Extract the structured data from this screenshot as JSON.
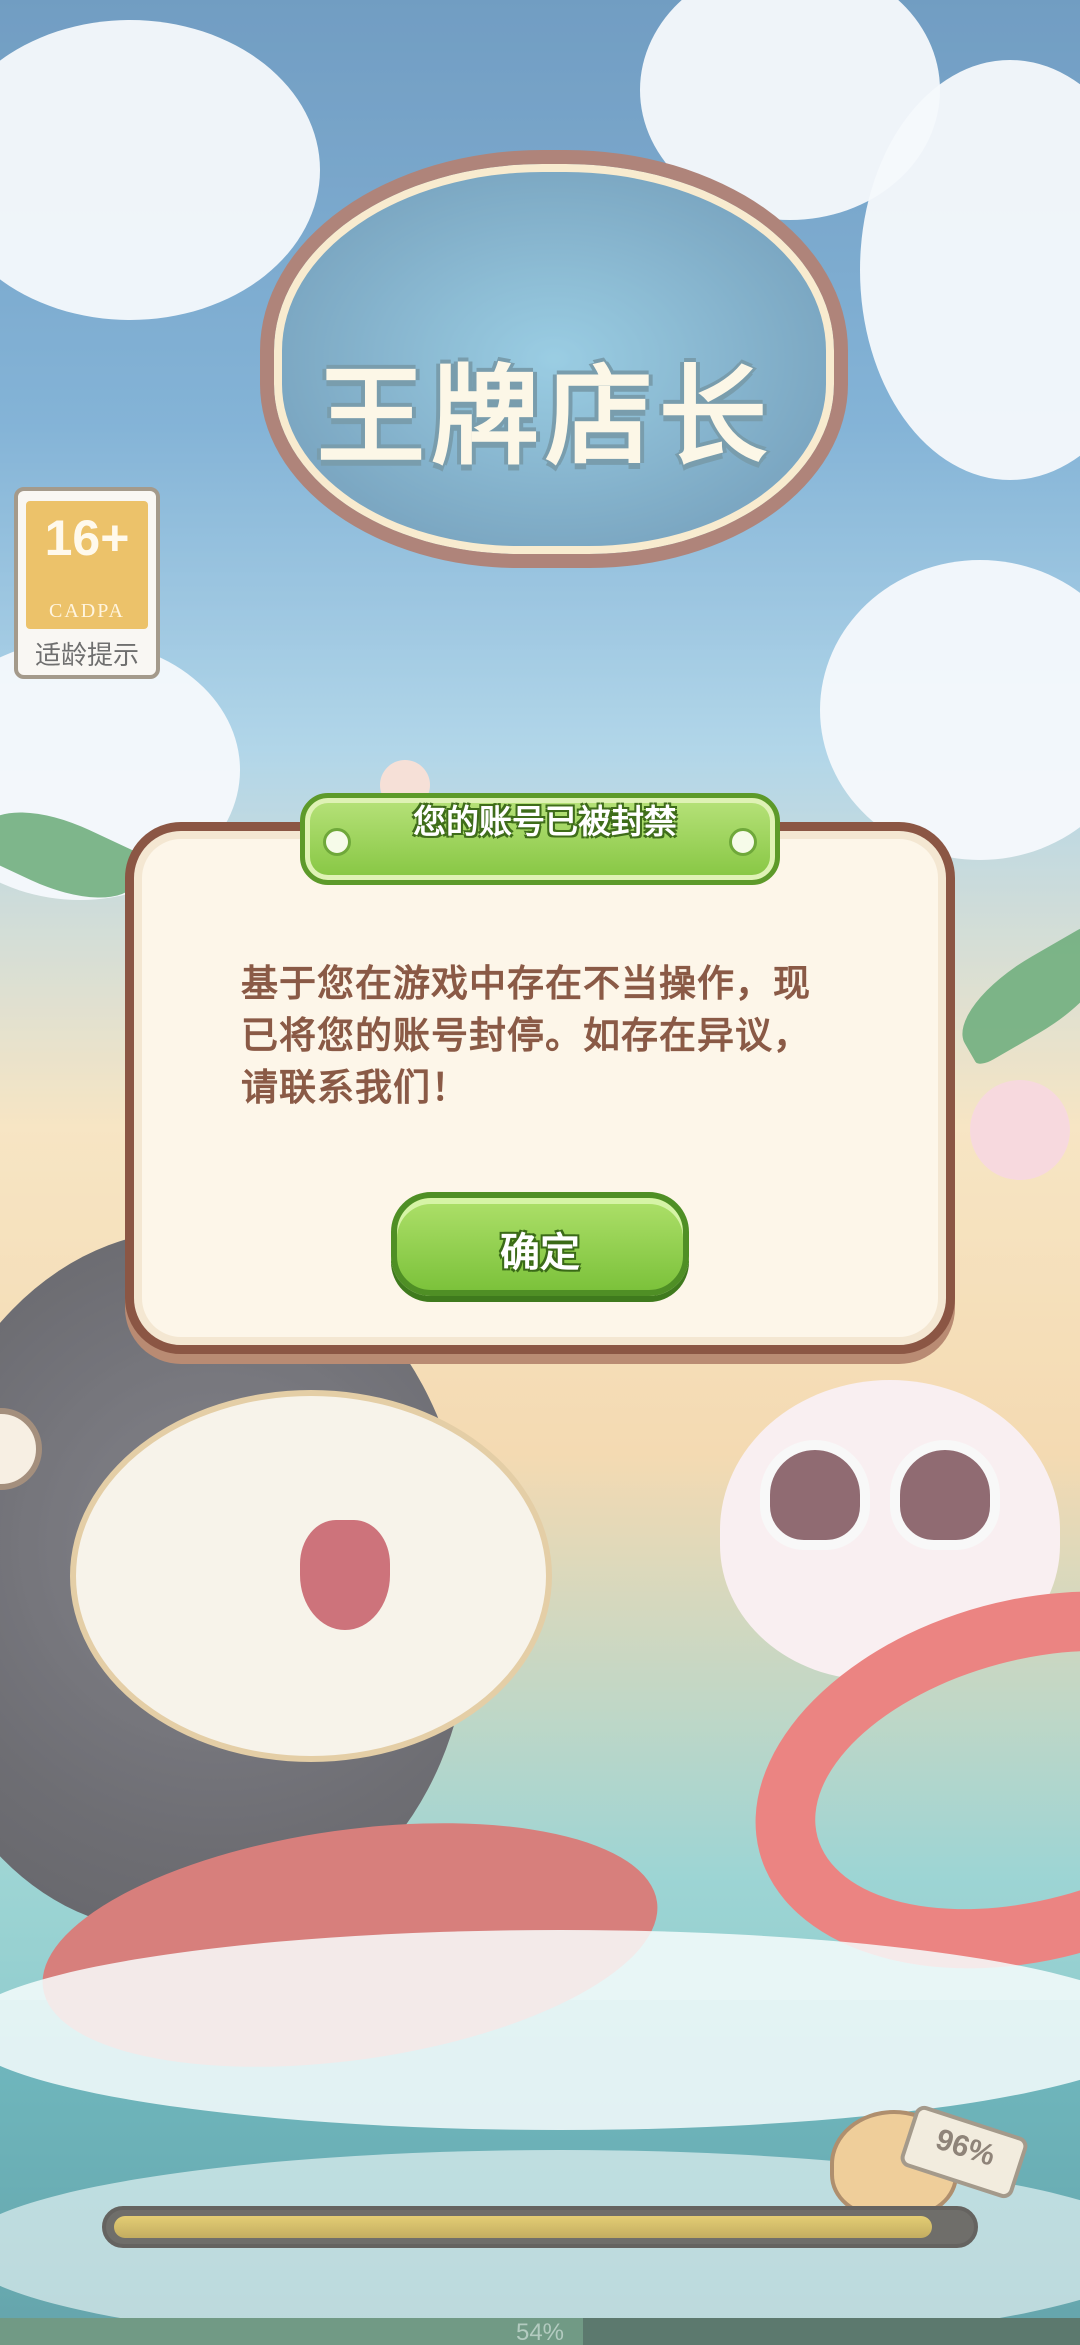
{
  "logo": {
    "title": "王牌店长"
  },
  "age_rating": {
    "number": "16+",
    "org": "CADPA",
    "hint": "适龄提示"
  },
  "dialog": {
    "title": "您的账号已被封禁",
    "message": "基于您在游戏中存在不当操作，现已将您的账号封停。如存在异议，请联系我们！",
    "confirm_label": "确定"
  },
  "loading": {
    "tag_text": "96%",
    "tag_progress": 0.96,
    "bottom_text": "54%",
    "bottom_progress": 0.54
  },
  "colors": {
    "dialog_border": "#8b5644",
    "dialog_bg": "#fdf6e9",
    "button_green": "#86c642",
    "message_text": "#8a5a46"
  },
  "icons": {
    "side_button": "gear-icon",
    "pins": "pin-icon"
  }
}
